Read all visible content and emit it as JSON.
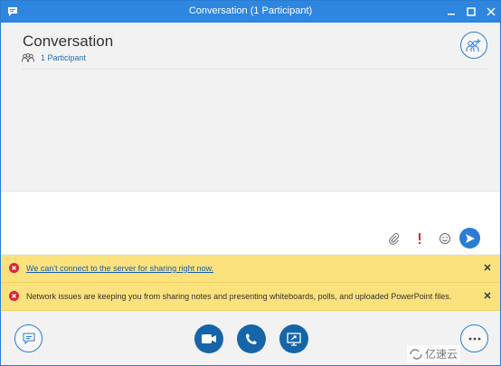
{
  "window": {
    "title": "Conversation (1 Participant)",
    "accent": "#2e86de"
  },
  "header": {
    "title": "Conversation",
    "participants_label": "1 Participant"
  },
  "compose": {
    "tools": [
      "paperclip-icon",
      "exclamation-icon",
      "smiley-icon",
      "send-icon"
    ]
  },
  "alerts": [
    {
      "text": "We can't connect to the server for sharing right now.",
      "is_link": true
    },
    {
      "text": "Network issues are keeping you from sharing notes and presenting whiteboards, polls, and uploaded PowerPoint files.",
      "is_link": false
    }
  ],
  "toolbar": {
    "buttons": [
      "chat-icon",
      "video-icon",
      "phone-icon",
      "present-screen-icon",
      "more-icon"
    ],
    "action_color": "#1565a8"
  },
  "watermark": {
    "text": "亿速云"
  }
}
